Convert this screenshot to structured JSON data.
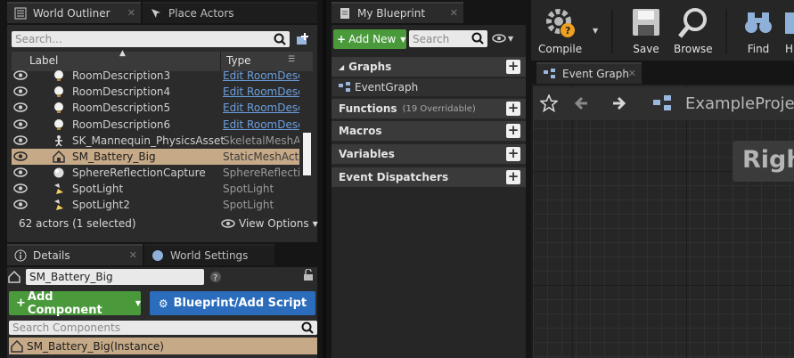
{
  "outliner": {
    "tab_outliner": "World Outliner",
    "tab_place_actors": "Place Actors",
    "search_placeholder": "Search...",
    "col_label": "Label",
    "col_type": "Type",
    "rows": [
      {
        "label": "RoomDescription3",
        "type": "Edit RoomDesc",
        "link": true,
        "icon": "lightbulb-icon"
      },
      {
        "label": "RoomDescription4",
        "type": "Edit RoomDesc",
        "link": true,
        "icon": "lightbulb-icon"
      },
      {
        "label": "RoomDescription5",
        "type": "Edit RoomDesc",
        "link": true,
        "icon": "lightbulb-icon"
      },
      {
        "label": "RoomDescription6",
        "type": "Edit RoomDesc",
        "link": true,
        "icon": "lightbulb-icon"
      },
      {
        "label": "SK_Mannequin_PhysicsAsset",
        "type": "SkeletalMeshAct",
        "link": false,
        "icon": "skeleton-icon"
      },
      {
        "label": "SM_Battery_Big",
        "type": "StaticMeshActor",
        "link": false,
        "icon": "static-mesh-icon",
        "selected": true
      },
      {
        "label": "SphereReflectionCapture",
        "type": "SphereReflection",
        "link": false,
        "icon": "sphere-capture-icon"
      },
      {
        "label": "SpotLight",
        "type": "SpotLight",
        "link": false,
        "icon": "spotlight-icon"
      },
      {
        "label": "SpotLight2",
        "type": "SpotLight",
        "link": false,
        "icon": "spotlight-icon"
      }
    ],
    "status": "62 actors (1 selected)",
    "view_options": "View Options"
  },
  "details": {
    "tab_details": "Details",
    "tab_world_settings": "World Settings",
    "actor_name": "SM_Battery_Big",
    "add_component": "Add Component",
    "blueprint_script": "Blueprint/Add Script",
    "search_components_placeholder": "Search Components",
    "instance_label": "SM_Battery_Big(Instance)"
  },
  "my_blueprint": {
    "tab": "My Blueprint",
    "add_new": "Add New",
    "search_placeholder": "Search",
    "graphs": "Graphs",
    "event_graph_item": "EventGraph",
    "functions": "Functions",
    "functions_count": "(19 Overridable)",
    "macros": "Macros",
    "variables": "Variables",
    "event_dispatchers": "Event Dispatchers"
  },
  "toolbar": {
    "compile": "Compile",
    "save": "Save",
    "browse": "Browse",
    "find": "Find",
    "hide": "H"
  },
  "graph": {
    "tab": "Event Graph",
    "breadcrumb": "ExampleProjec",
    "watermark": "Righ"
  }
}
